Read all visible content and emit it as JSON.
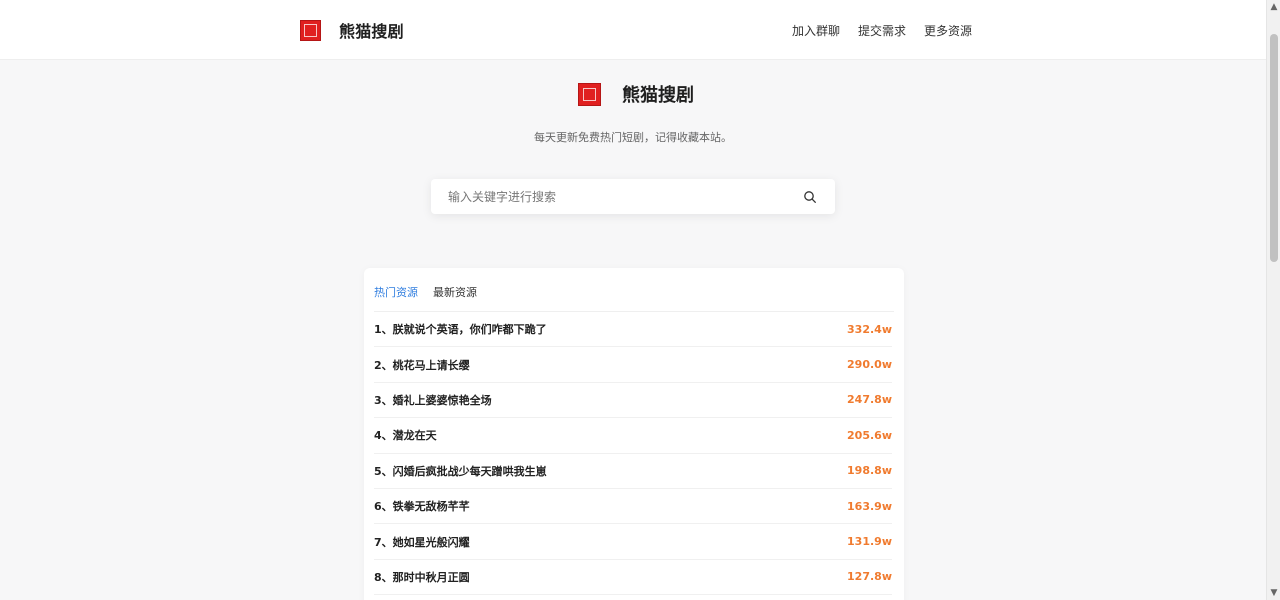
{
  "header": {
    "title": "熊猫搜剧",
    "nav": [
      {
        "label": "加入群聊"
      },
      {
        "label": "提交需求"
      },
      {
        "label": "更多资源"
      }
    ]
  },
  "hero": {
    "title": "熊猫搜剧",
    "subtitle": "每天更新免费热门短剧，记得收藏本站。"
  },
  "search": {
    "placeholder": "输入关键字进行搜索",
    "icon": "search-icon"
  },
  "tabs": [
    {
      "label": "热门资源"
    },
    {
      "label": "最新资源"
    }
  ],
  "list": [
    {
      "title": "1、朕就说个英语，你们咋都下跪了",
      "heat": "332.4w"
    },
    {
      "title": "2、桃花马上请长缨",
      "heat": "290.0w"
    },
    {
      "title": "3、婚礼上婆婆惊艳全场",
      "heat": "247.8w"
    },
    {
      "title": "4、潜龙在天",
      "heat": "205.6w"
    },
    {
      "title": "5、闪婚后疯批战少每天蹭哄我生崽",
      "heat": "198.8w"
    },
    {
      "title": "6、铁拳无敌杨芊芊",
      "heat": "163.9w"
    },
    {
      "title": "7、她如星光般闪耀",
      "heat": "131.9w"
    },
    {
      "title": "8、那时中秋月正圆",
      "heat": "127.8w"
    }
  ],
  "colors": {
    "brand_red": "#e02020",
    "active_tab": "#2f7ddf",
    "heat": "#f07b2f"
  }
}
